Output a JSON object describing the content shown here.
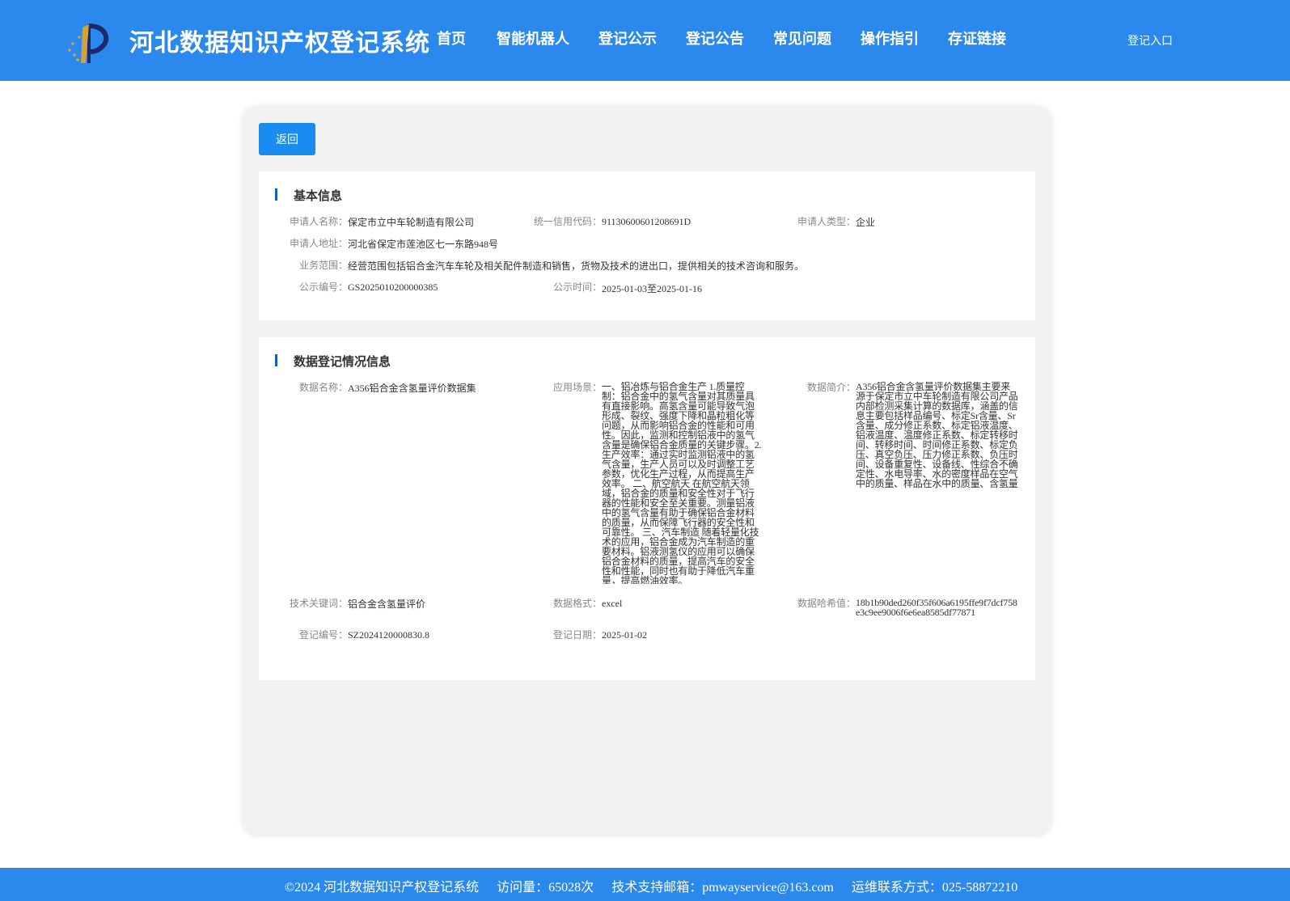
{
  "header": {
    "title": "河北数据知识产权登记系统",
    "nav": [
      "首页",
      "智能机器人",
      "登记公示",
      "登记公告",
      "常见问题",
      "操作指引",
      "存证链接"
    ],
    "login": "登记入口",
    "bg_color": "#2b88ec"
  },
  "back_button": "返回",
  "basic_info": {
    "title": "基本信息",
    "applicant_name_label": "申请人名称：",
    "applicant_name": "保定市立中车轮制造有限公司",
    "credit_code_label": "统一信用代码：",
    "credit_code": "91130600601208691D",
    "applicant_type_label": "申请人类型：",
    "applicant_type": "企业",
    "address_label": "申请人地址：",
    "address": "河北省保定市莲池区七一东路948号",
    "scope_label": "业务范围：",
    "scope": "经营范围包括铝合金汽车车轮及相关配件制造和销售，货物及技术的进出口，提供相关的技术咨询和服务。",
    "notice_no_label": "公示编号：",
    "notice_no": "GS2025010200000385",
    "notice_time_label": "公示时间：",
    "notice_time": "2025-01-03至2025-01-16"
  },
  "data_info": {
    "title": "数据登记情况信息",
    "data_name_label": "数据名称：",
    "data_name": "A356铝合金含氢量评价数据集",
    "scene_label": "应用场景：",
    "scene": "一、铝冶炼与铝合金生产 1.质量控制：铝合金中的氢气含量对其质量具有直接影响。高氢含量可能导致气泡形成、裂纹、强度下降和晶粒粗化等问题，从而影响铝合金的性能和可用性。因此，监测和控制铝液中的氢气含量是确保铝合金质量的关键步骤。2.生产效率：通过实时监测铝液中的氢气含量，生产人员可以及时调整工艺参数，优化生产过程，从而提高生产效率。 二、航空航天 在航空航天领域，铝合金的质量和安全性对于飞行器的性能和安全至关重要。测量铝液中的氢气含量有助于确保铝合金材料的质量，从而保障飞行器的安全性和可靠性。 三、汽车制造 随着轻量化技术的应用，铝合金成为汽车制造的重要材料。铝液测氢仪的应用可以确保铝合金材料的质量，提高汽车的安全性和性能，同时也有助于降低汽车重量，提高燃油效率。",
    "intro_label": "数据简介：",
    "intro": "A356铝合金含氢量评价数据集主要来源于保定市立中车轮制造有限公司产品内部检测采集计算的数据库，涵盖的信息主要包括样品编号、标定Sr含量、Sr含量、成分修正系数、标定铝液温度、铝液温度、温度修正系数、标定转移时间、转移时间、时间修正系数、标定负压、真空负压、压力修正系数、负压时间、设备重复性、设备线、性综合不确定性、水电导率、水的密度样品在空气中的质量、样品在水中的质量、含氢量",
    "keyword_label": "技术关键词：",
    "keyword": "铝合金含氢量评价",
    "format_label": "数据格式：",
    "format": "excel",
    "hash_label": "数据哈希值：",
    "hash": "18b1b90ded260f35f606a6195ffe9f7dcf758e3c9ee9006f6e6ea8585df77871",
    "reg_no_label": "登记编号：",
    "reg_no": "SZ2024120000830.8",
    "reg_date_label": "登记日期：",
    "reg_date": "2025-01-02"
  },
  "footer": {
    "copyright": "©2024 河北数据知识产权登记系统",
    "visits": "访问量：65028次",
    "email": "技术支持邮箱：pmwayservice@163.com",
    "contact": "运维联系方式：025-58872210"
  }
}
